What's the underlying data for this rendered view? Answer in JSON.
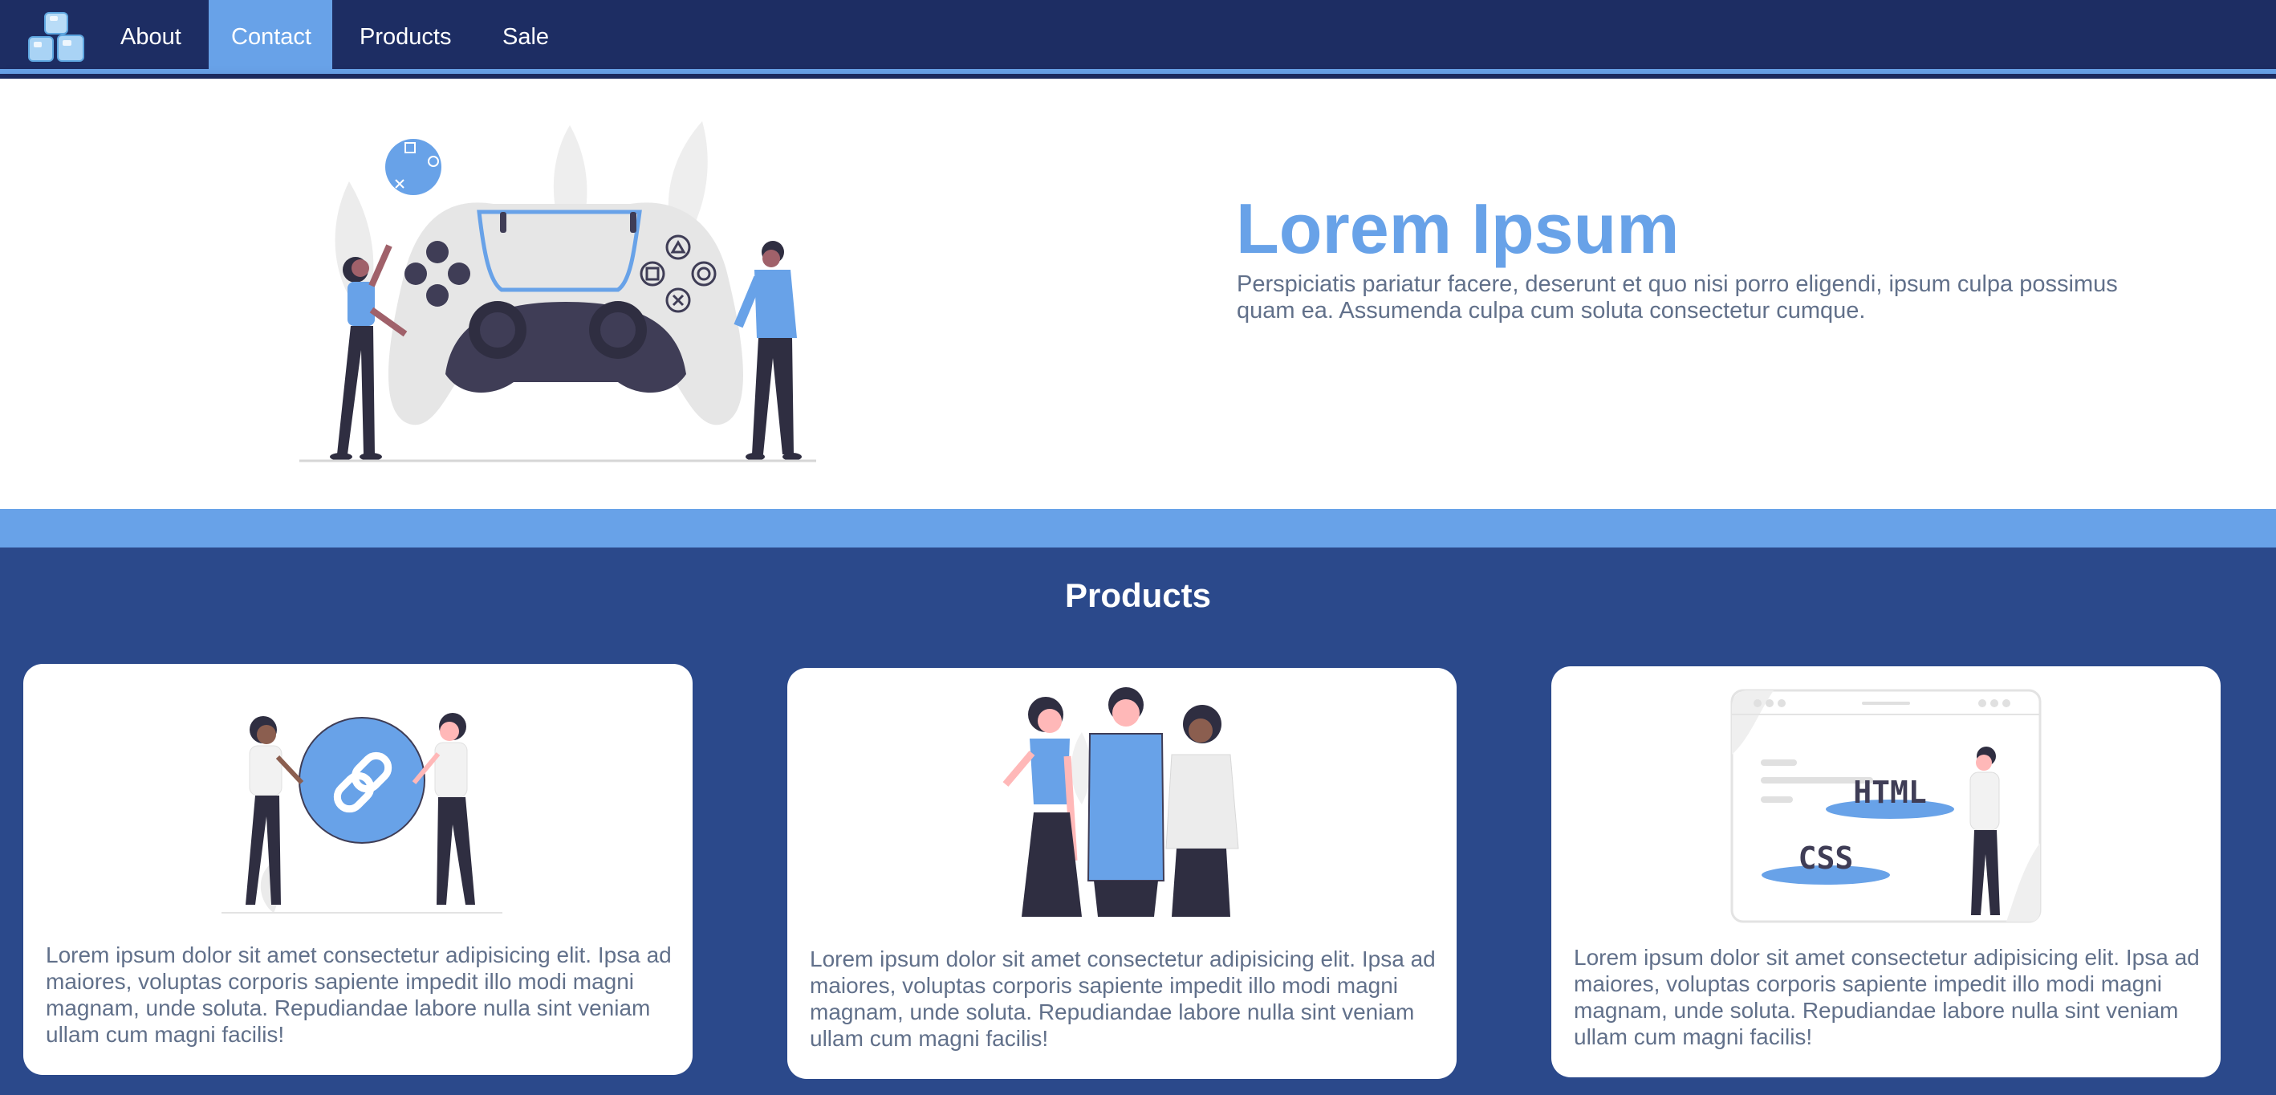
{
  "nav": {
    "items": [
      {
        "label": "About",
        "active": false
      },
      {
        "label": "Contact",
        "active": true
      },
      {
        "label": "Products",
        "active": false
      },
      {
        "label": "Sale",
        "active": false
      }
    ]
  },
  "hero": {
    "title": "Lorem Ipsum",
    "text": "Perspiciatis pariatur facere, deserunt et quo nisi porro eligendi, ipsum culpa possimus quam ea. Assumenda culpa cum soluta consectetur cumque."
  },
  "products": {
    "heading": "Products",
    "cards": [
      {
        "illustration": "people-with-link-icon",
        "text": "Lorem ipsum dolor sit amet consectetur adipisicing elit. Ipsa ad maiores, voluptas corporis sapiente impedit illo modi magni magnam, unde soluta. Repudiandae labore nulla sint veniam ullam cum magni facilis!"
      },
      {
        "illustration": "group-of-people",
        "text": "Lorem ipsum dolor sit amet consectetur adipisicing elit. Ipsa ad maiores, voluptas corporis sapiente impedit illo modi magni magnam, unde soluta. Repudiandae labore nulla sint veniam ullam cum magni facilis!"
      },
      {
        "illustration": "html-css-browser",
        "text": "Lorem ipsum dolor sit amet consectetur adipisicing elit. Ipsa ad maiores, voluptas corporis sapiente impedit illo modi magni magnam, unde soluta. Repudiandae labore nulla sint veniam ullam cum magni facilis!",
        "tags": [
          "HTML",
          "CSS"
        ]
      }
    ]
  },
  "colors": {
    "nav_bg": "#1d2d63",
    "accent": "#68a2e8",
    "products_bg": "#2b498b",
    "body_text": "#61708a"
  }
}
